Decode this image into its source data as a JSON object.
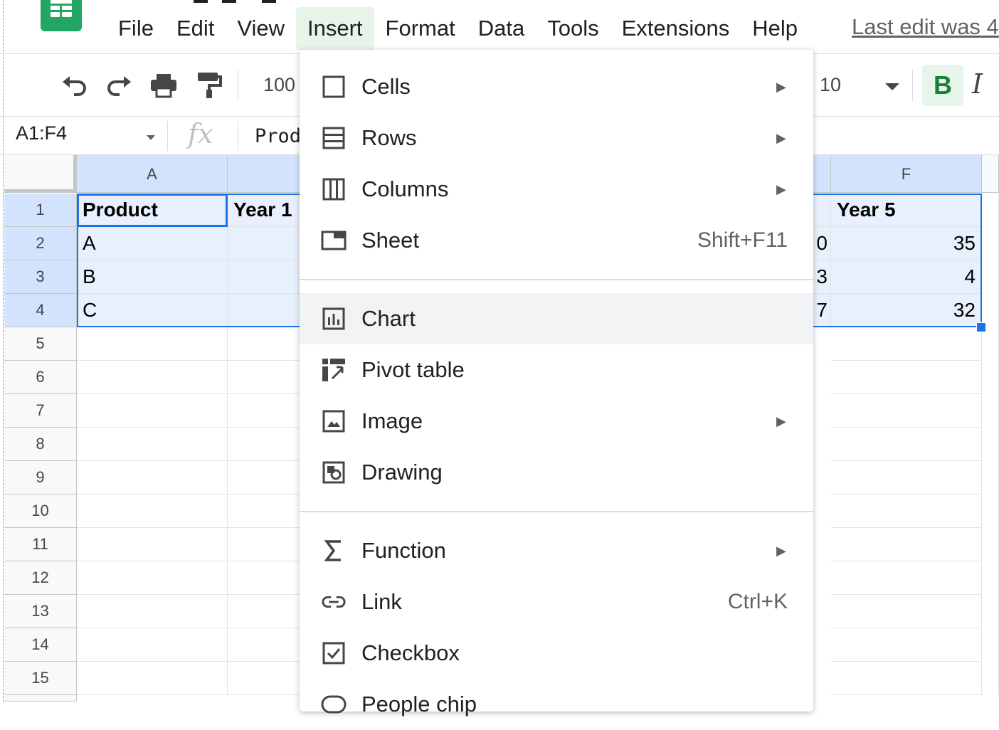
{
  "menubar": {
    "items": [
      "File",
      "Edit",
      "View",
      "Insert",
      "Format",
      "Data",
      "Tools",
      "Extensions",
      "Help"
    ],
    "active": "Insert",
    "last_edit": "Last edit was 4"
  },
  "toolbar": {
    "zoom": "100",
    "font_size": "10",
    "bold_label": "B",
    "italic_label": "I"
  },
  "formula_bar": {
    "name_box": "A1:F4",
    "fx_label": "fx",
    "content": "Prod"
  },
  "grid": {
    "col_headers": [
      "A",
      "F"
    ],
    "row_headers": [
      "1",
      "2",
      "3",
      "4",
      "5",
      "6",
      "7",
      "8",
      "9",
      "10",
      "11",
      "12",
      "13",
      "14",
      "15"
    ],
    "colA": [
      "Product",
      "A",
      "B",
      "C"
    ],
    "colB_header": "Year 1",
    "colE_partial": [
      "0",
      "3",
      "7"
    ],
    "colF": [
      "Year 5",
      "35",
      "4",
      "32"
    ]
  },
  "insert_menu": {
    "items": [
      {
        "label": "Cells",
        "icon": "cells-icon",
        "submenu": true
      },
      {
        "label": "Rows",
        "icon": "rows-icon",
        "submenu": true
      },
      {
        "label": "Columns",
        "icon": "columns-icon",
        "submenu": true
      },
      {
        "label": "Sheet",
        "icon": "sheet-icon",
        "shortcut": "Shift+F11"
      },
      {
        "label": "Chart",
        "icon": "chart-icon",
        "highlighted": true
      },
      {
        "label": "Pivot table",
        "icon": "pivot-table-icon"
      },
      {
        "label": "Image",
        "icon": "image-icon",
        "submenu": true
      },
      {
        "label": "Drawing",
        "icon": "drawing-icon"
      },
      {
        "label": "Function",
        "icon": "sigma-icon",
        "submenu": true
      },
      {
        "label": "Link",
        "icon": "link-icon",
        "shortcut": "Ctrl+K"
      },
      {
        "label": "Checkbox",
        "icon": "checkbox-icon"
      },
      {
        "label": "People chip",
        "icon": "people-chip-icon"
      }
    ],
    "arrow_glyph": "▶"
  },
  "colors": {
    "accent": "#1a73e8",
    "brand_green": "#23a566",
    "menu_active_bg": "#e6f4ea",
    "selection_fill": "#e8f0fe",
    "highlight_row": "#f1f3f4"
  }
}
